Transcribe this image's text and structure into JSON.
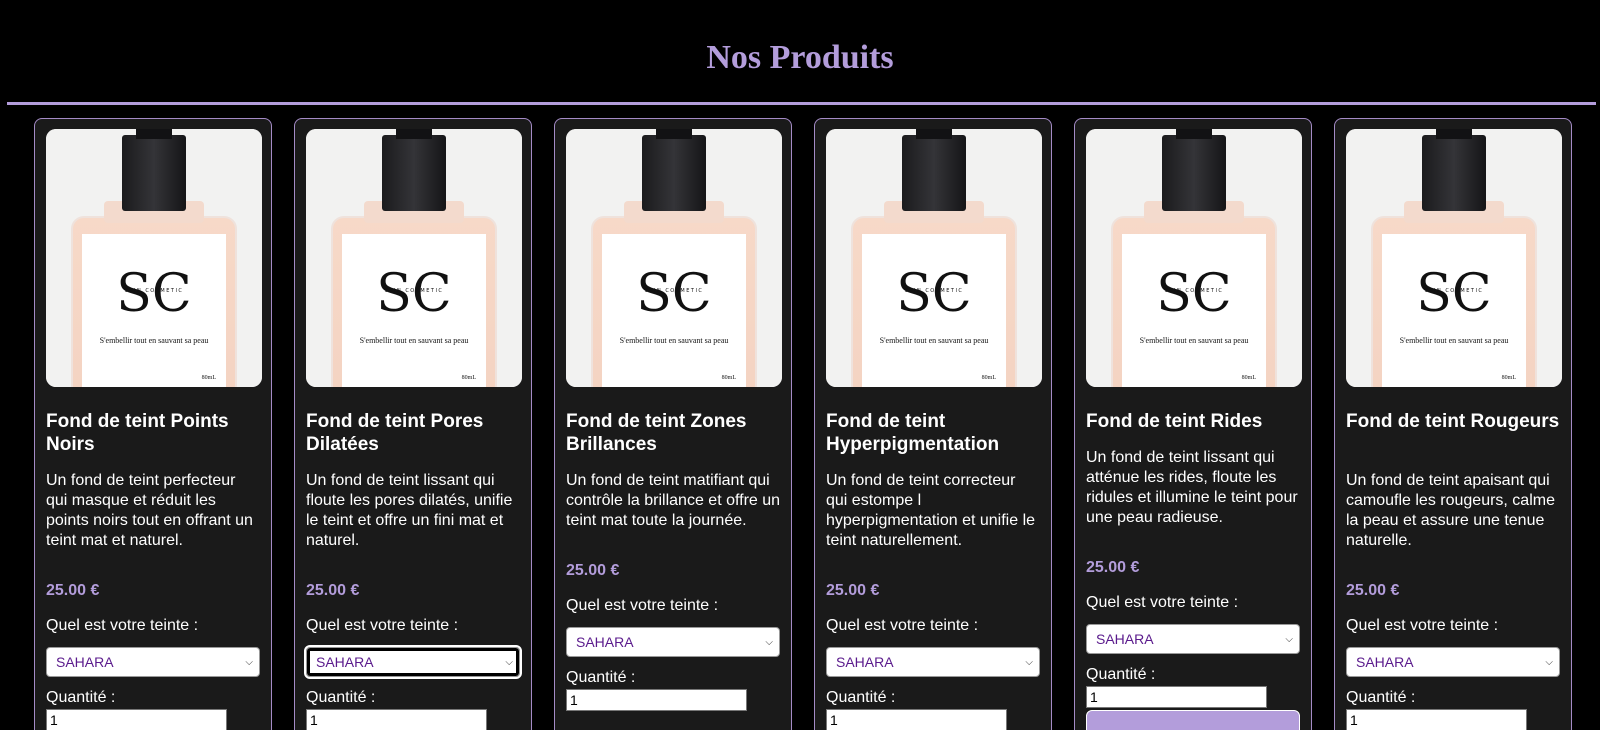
{
  "page": {
    "title": "Nos Produits"
  },
  "product_image": {
    "slogan": "S'embellir tout en sauvant sa peau",
    "brand": "SKIN COSMETIC",
    "volume": "80mL"
  },
  "products": [
    {
      "name": "Fond de teint Points Noirs",
      "description": "Un fond de teint perfecteur qui masque et réduit les points noirs tout en offrant un teint mat et naturel.",
      "price": "25.00 €",
      "shade_label": "Quel est votre teinte :",
      "shade_value": "SAHARA",
      "qty_label": "Quantité :",
      "qty_value": "1"
    },
    {
      "name": "Fond de teint Pores Dilatées",
      "description": "Un fond de teint lissant qui floute les pores dilatés, unifie le teint et offre un fini mat et naturel.",
      "price": "25.00 €",
      "shade_label": "Quel est votre teinte :",
      "shade_value": "SAHARA",
      "qty_label": "Quantité :",
      "qty_value": "1"
    },
    {
      "name": "Fond de teint Zones Brillances",
      "description": "Un fond de teint matifiant qui contrôle la brillance et offre un teint mat toute la journée.",
      "price": "25.00 €",
      "shade_label": "Quel est votre teinte :",
      "shade_value": "SAHARA",
      "qty_label": "Quantité :",
      "qty_value": "1"
    },
    {
      "name": "Fond de teint Hyperpigmentation",
      "description": "Un fond de teint correcteur qui estompe l hyperpigmentation et unifie le teint naturellement.",
      "price": "25.00 €",
      "shade_label": "Quel est votre teinte :",
      "shade_value": "SAHARA",
      "qty_label": "Quantité :",
      "qty_value": "1"
    },
    {
      "name": "Fond de teint Rides",
      "description": "Un fond de teint lissant qui atténue les rides, floute les ridules et illumine le teint pour une peau radieuse.",
      "price": "25.00 €",
      "shade_label": "Quel est votre teinte :",
      "shade_value": "SAHARA",
      "qty_label": "Quantité :",
      "qty_value": "1"
    },
    {
      "name": "Fond de teint Rougeurs",
      "description": "Un fond de teint apaisant qui camoufle les rougeurs, calme la peau et assure une tenue naturelle.",
      "price": "25.00 €",
      "shade_label": "Quel est votre teinte :",
      "shade_value": "SAHARA",
      "qty_label": "Quantité :",
      "qty_value": "1"
    }
  ],
  "colors": {
    "accent": "#b39ddb",
    "background": "#000000",
    "card": "#1a1a1a"
  }
}
